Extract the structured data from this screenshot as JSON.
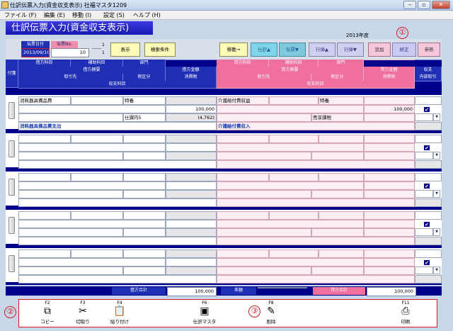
{
  "window": {
    "title": "仕訳伝票入力(資金収支表示) 社福マスタ1209",
    "min_btn": "‒",
    "max_btn": "▫",
    "close_btn": "✕"
  },
  "menu": [
    "ファイル (F)",
    "編集 (E)",
    "移動 (I)",
    "設定 (S)",
    "ヘルプ (H)"
  ],
  "page": {
    "title": "仕訳伝票入力(資金収支表示)",
    "fiscal_year": "2013年度"
  },
  "callouts": {
    "c1": "①",
    "c2": "②",
    "c3": "③"
  },
  "slip": {
    "date_label": "伝票日付",
    "no_label": "伝票No.",
    "date_value": "2013/09/10",
    "no_value": "10",
    "page_top": "1",
    "page_bottom": "1",
    "dashes": "------"
  },
  "buttons": {
    "display": "表示",
    "search": "検索条件",
    "move": "移動→",
    "first": "仕訳▲",
    "slip_down": "伝票▼",
    "row_up": "行挿▲",
    "row_down": "行挿▼",
    "add": "追加",
    "edit": "修正",
    "ref": "参照"
  },
  "headers": {
    "fusen": "付箋",
    "debit_account": "借方科目",
    "debit_sub": "補助科目",
    "dept": "部門",
    "debit_summary": "借方摘要",
    "debit_amount": "借方金額",
    "partner": "取引先",
    "tax_class": "税区分",
    "tax": "消費税",
    "budget_account": "収支科目",
    "credit_account": "貸方科目",
    "credit_sub": "補助科目",
    "credit_dept": "部門",
    "credit_summary": "貸方摘要",
    "credit_amount": "貸方金額",
    "income": "収支",
    "internal": "内部取引",
    "credit_partner": "取引先",
    "credit_tax_class": "税区分",
    "credit_tax": "消費税",
    "credit_budget": "収支科目"
  },
  "row1": {
    "debit_account": "消耗器具備品費",
    "debit_dept": "特養",
    "debit_amount": "100,000",
    "debit_tax_class": "仕課内5",
    "debit_tax": "(4,762)",
    "debit_budget": "消耗器具備品費支出",
    "credit_account": "介護給付費収益",
    "credit_dept": "特養",
    "credit_amount": "100,000",
    "credit_tax_class": "売非課税",
    "credit_budget": "介護給付費収入",
    "check": "✔",
    "dd": "▼"
  },
  "totals": {
    "debit_label": "借方合計",
    "debit_value": "100,000",
    "diff_label": "差額",
    "diff_value": "",
    "credit_label": "貸方合計",
    "credit_value": "100,000"
  },
  "fkeys": [
    {
      "key": "F2",
      "label": "コピー",
      "icon": "copy-icon",
      "glyph": "⧉"
    },
    {
      "key": "F3",
      "label": "切取り",
      "icon": "scissors-icon",
      "glyph": "✂"
    },
    {
      "key": "F4",
      "label": "貼り付け",
      "icon": "clipboard-icon",
      "glyph": "📋"
    },
    {
      "key": "F6",
      "label": "仕訳マスタ",
      "icon": "master-icon",
      "glyph": "▣"
    },
    {
      "key": "F8",
      "label": "削除",
      "icon": "eraser-icon",
      "glyph": "✎"
    },
    {
      "key": "F11",
      "label": "印刷",
      "icon": "printer-icon",
      "glyph": "⎙"
    }
  ]
}
